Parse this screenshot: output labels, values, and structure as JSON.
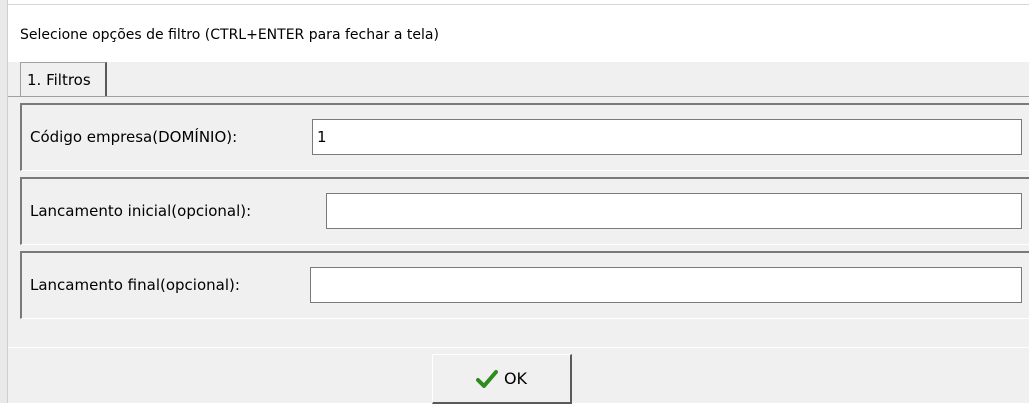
{
  "dialog": {
    "instruction": "Selecione opções de filtro (CTRL+ENTER para fechar a tela)"
  },
  "tabs": [
    {
      "label": "1. Filtros",
      "selected": true
    }
  ],
  "fields": {
    "codigo_empresa": {
      "label": "Código empresa(DOMÍNIO):",
      "value": "1"
    },
    "lancamento_inicial": {
      "label": "Lancamento inicial(opcional):",
      "value": ""
    },
    "lancamento_final": {
      "label": "Lancamento final(opcional):",
      "value": ""
    }
  },
  "buttons": {
    "ok": {
      "label": "OK",
      "icon": "check-icon",
      "icon_color": "#2e8b1e"
    }
  }
}
